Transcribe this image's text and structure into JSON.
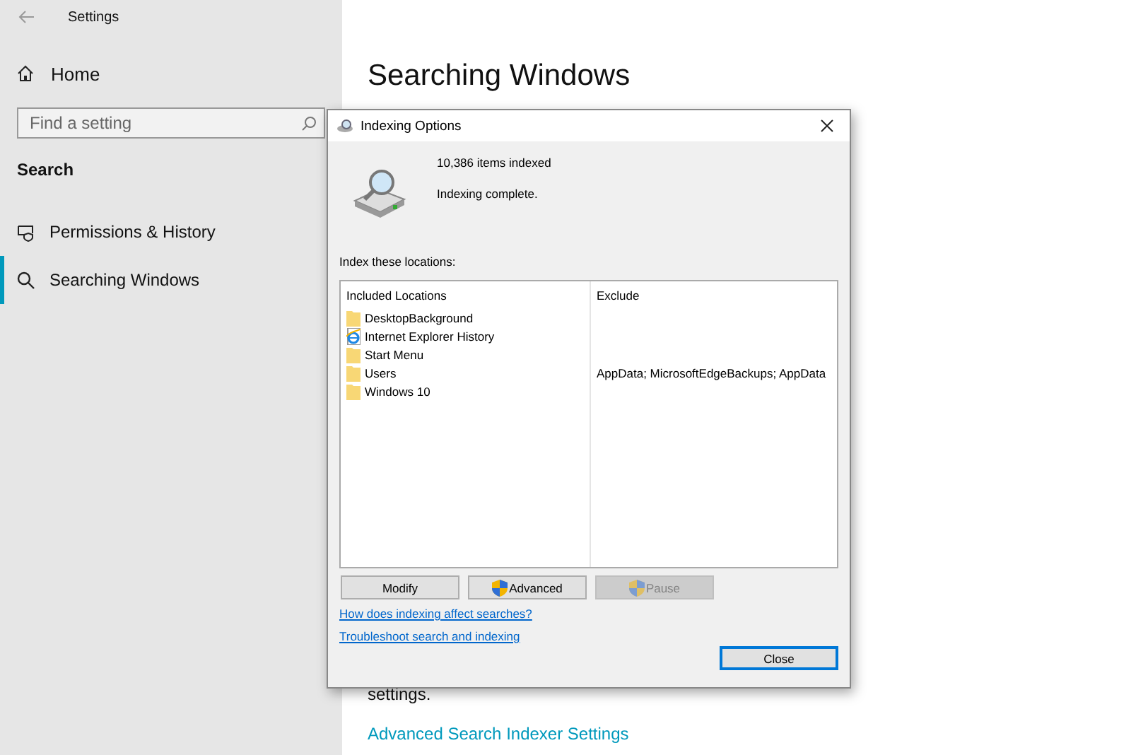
{
  "window": {
    "title": "Settings"
  },
  "sidebar": {
    "home": "Home",
    "search": {
      "placeholder": "Find a setting"
    },
    "section": "Search",
    "items": [
      {
        "label": "Permissions & History",
        "kind": "shield",
        "selected": false
      },
      {
        "label": "Searching Windows",
        "kind": "search",
        "selected": true
      }
    ]
  },
  "main": {
    "heading": "Searching Windows",
    "trailing_text": "settings.",
    "link": "Advanced Search Indexer Settings"
  },
  "dialog": {
    "title": "Indexing Options",
    "count": "10,386 items indexed",
    "status": "Indexing complete.",
    "list_label": "Index these locations:",
    "columns": [
      "Included Locations",
      "Exclude"
    ],
    "rows": [
      {
        "location": "DesktopBackground",
        "kind": "folder"
      },
      {
        "location": "Internet Explorer History",
        "kind": "browser"
      },
      {
        "location": "Start Menu",
        "kind": "folder"
      },
      {
        "location": "Users",
        "kind": "folder",
        "exclude": "AppData; MicrosoftEdgeBackups; AppData"
      },
      {
        "location": "Windows 10",
        "kind": "folder"
      }
    ],
    "buttons": [
      {
        "label": "Modify",
        "shield": false,
        "disabled": false
      },
      {
        "label": "Advanced",
        "shield": true,
        "disabled": false
      },
      {
        "label": "Pause",
        "shield": true,
        "disabled": true
      }
    ],
    "links": [
      "How does indexing affect searches?",
      "Troubleshoot search and indexing"
    ],
    "close_button": {
      "label": "Close",
      "default": true
    }
  }
}
